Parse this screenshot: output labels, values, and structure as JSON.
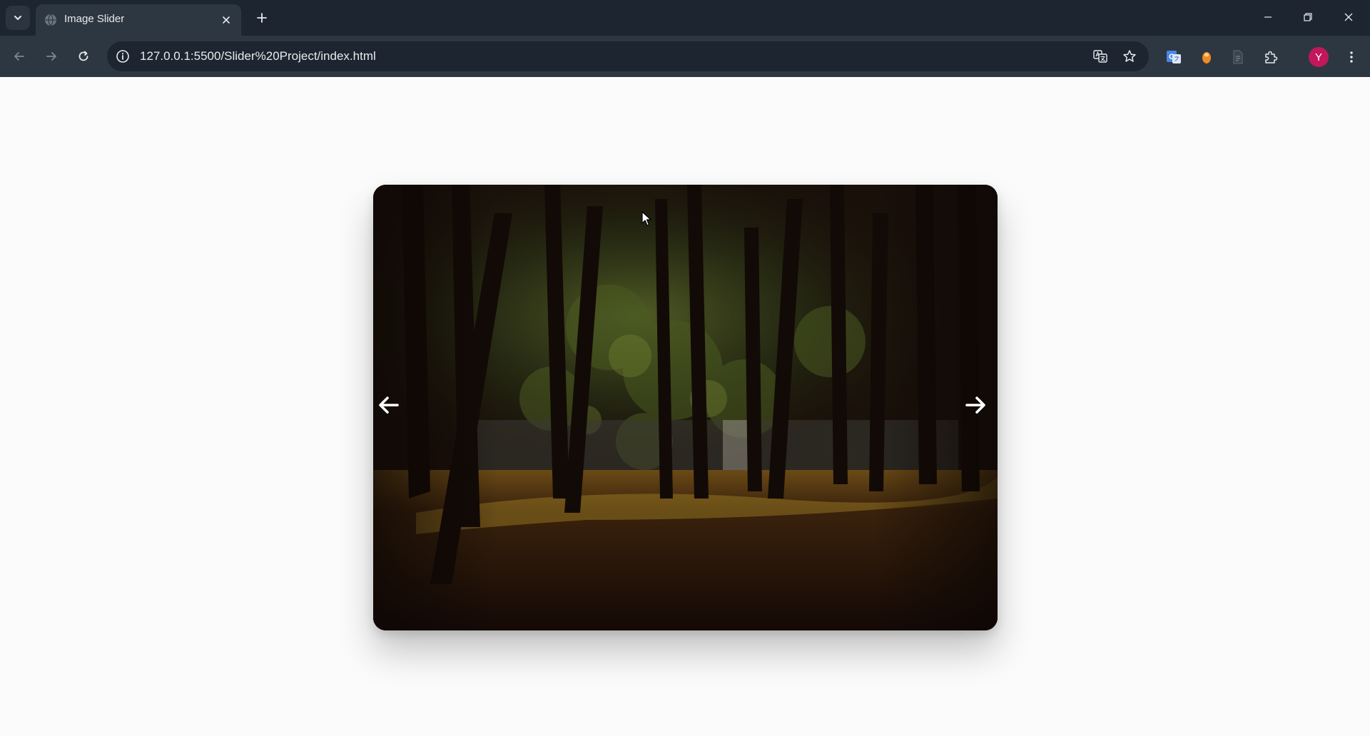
{
  "browser": {
    "tab": {
      "title": "Image Slider"
    },
    "address_bar": {
      "url": "127.0.0.1:5500/Slider%20Project/index.html"
    },
    "profile_initial": "Y"
  },
  "slider": {
    "image": "dark forest with sunlit trees",
    "prev_icon": "arrow-left-icon",
    "next_icon": "arrow-right-icon"
  }
}
